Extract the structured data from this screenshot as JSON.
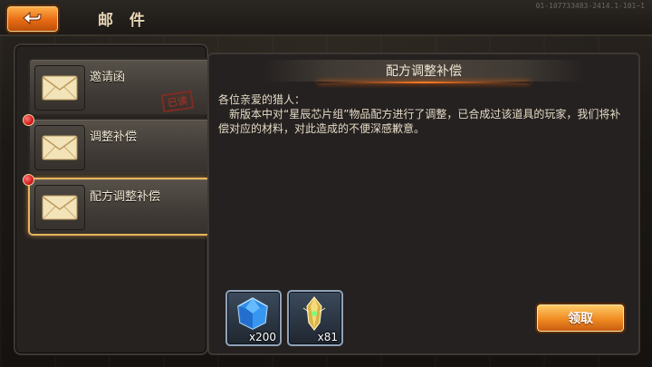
{
  "header": {
    "title": "邮 件",
    "build_code": "01-107733483-2414.1-101~1"
  },
  "mail_list": [
    {
      "subject": "邀请函",
      "read_stamp": "已读",
      "has_dot": false,
      "selected": false
    },
    {
      "subject": "调整补偿",
      "read_stamp": "",
      "has_dot": true,
      "selected": false
    },
    {
      "subject": "配方调整补偿",
      "read_stamp": "",
      "has_dot": true,
      "selected": true
    }
  ],
  "detail": {
    "title": "配方调整补偿",
    "greeting": "各位亲爱的猎人：",
    "body": "新版本中对“星辰芯片组”物品配方进行了调整，已合成过该道具的玩家，我们将补偿对应的材料，对此造成的不便深感歉意。",
    "rewards": [
      {
        "icon": "blue-crystal-icon",
        "quantity": "x200"
      },
      {
        "icon": "gold-shard-icon",
        "quantity": "x81"
      }
    ],
    "claim_label": "领取"
  },
  "colors": {
    "accent_orange": "#f08a22",
    "selected_border": "#e8b45a",
    "unread_dot": "#d61c1c"
  }
}
